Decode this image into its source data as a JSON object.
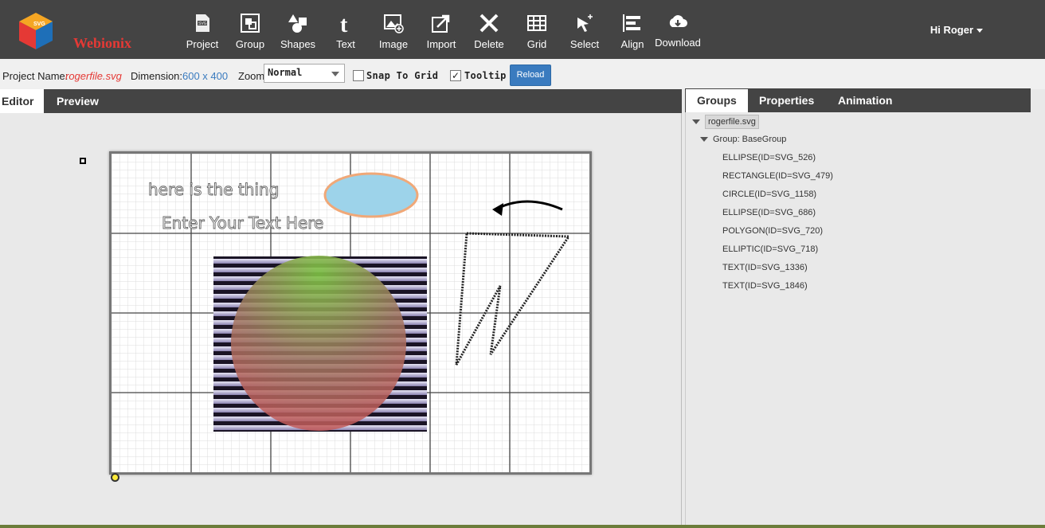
{
  "app": {
    "name": "Webionix",
    "logo_icon": "svg-cube-logo"
  },
  "toolbar": {
    "items": [
      {
        "label": "Project",
        "icon": "svg-file-icon"
      },
      {
        "label": "Group",
        "icon": "group-icon"
      },
      {
        "label": "Shapes",
        "icon": "shapes-icon"
      },
      {
        "label": "Text",
        "icon": "text-icon"
      },
      {
        "label": "Image",
        "icon": "image-icon"
      },
      {
        "label": "Import",
        "icon": "import-icon"
      },
      {
        "label": "Delete",
        "icon": "delete-icon"
      },
      {
        "label": "Grid",
        "icon": "grid-icon"
      },
      {
        "label": "Select",
        "icon": "select-icon"
      },
      {
        "label": "Align",
        "icon": "align-icon"
      },
      {
        "label": "Download",
        "icon": "download-icon"
      }
    ]
  },
  "user": {
    "greeting": "Hi Roger"
  },
  "project": {
    "name_label": "Project Name:",
    "name": "rogerfile.svg",
    "dimension_label": "Dimension:",
    "dimension": "600 x 400",
    "zoom_label": "Zoom",
    "zoom_value": "Normal",
    "snap_label": "Snap To Grid",
    "snap_checked": false,
    "tooltip_label": "Tooltip",
    "tooltip_checked": true,
    "reload_label": "Reload"
  },
  "editor_tabs": [
    {
      "label": "Editor",
      "active": true
    },
    {
      "label": "Preview",
      "active": false
    }
  ],
  "canvas": {
    "text1": "here is the thing",
    "text2": "Enter Your Text Here",
    "colors": {
      "ellipse_fill": "#9dd3ea",
      "ellipse_stroke": "#f0a878",
      "grid_major": "#444444",
      "grid_minor": "#dddddd"
    }
  },
  "right_tabs": [
    {
      "label": "Groups",
      "active": true
    },
    {
      "label": "Properties",
      "active": false
    },
    {
      "label": "Animation",
      "active": false
    }
  ],
  "tree": {
    "root": "rogerfile.svg",
    "group": "Group: BaseGroup",
    "items": [
      "ELLIPSE(ID=SVG_526)",
      "RECTANGLE(ID=SVG_479)",
      "CIRCLE(ID=SVG_1158)",
      "ELLIPSE(ID=SVG_686)",
      "POLYGON(ID=SVG_720)",
      "ELLIPTIC(ID=SVG_718)",
      "TEXT(ID=SVG_1336)",
      "TEXT(ID=SVG_1846)"
    ]
  }
}
